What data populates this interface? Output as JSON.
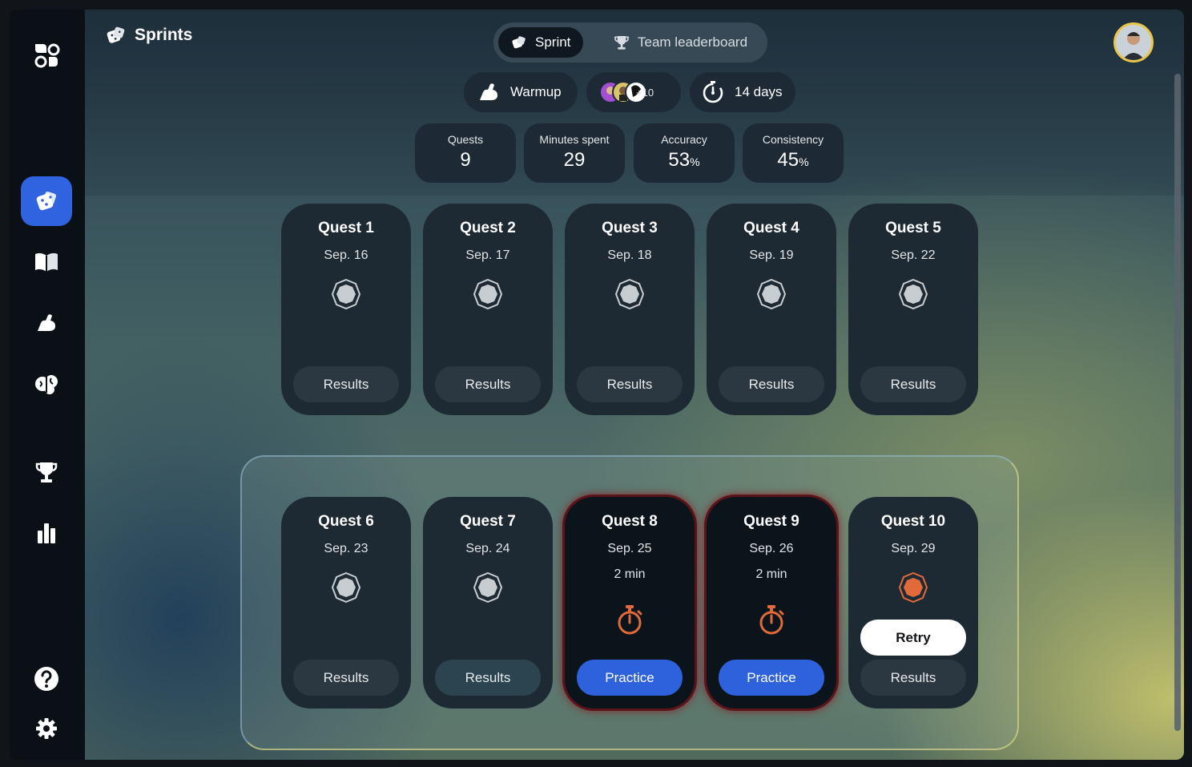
{
  "header": {
    "title": "Sprints"
  },
  "tabs": {
    "sprint": "Sprint",
    "leaderboard": "Team leaderboard"
  },
  "pills": {
    "warmup": "Warmup",
    "members_extra": "+10",
    "duration": "14 days"
  },
  "stats": [
    {
      "label": "Quests",
      "value": "9",
      "unit": ""
    },
    {
      "label": "Minutes spent",
      "value": "29",
      "unit": ""
    },
    {
      "label": "Accuracy",
      "value": "53",
      "unit": "%"
    },
    {
      "label": "Consistency",
      "value": "45",
      "unit": "%"
    }
  ],
  "quests": [
    {
      "title": "Quest 1",
      "date": "Sep. 16",
      "results": "Results"
    },
    {
      "title": "Quest 2",
      "date": "Sep. 17",
      "results": "Results"
    },
    {
      "title": "Quest 3",
      "date": "Sep. 18",
      "results": "Results"
    },
    {
      "title": "Quest 4",
      "date": "Sep. 19",
      "results": "Results"
    },
    {
      "title": "Quest 5",
      "date": "Sep. 22",
      "results": "Results"
    },
    {
      "title": "Quest 6",
      "date": "Sep. 23",
      "results": "Results"
    },
    {
      "title": "Quest 7",
      "date": "Sep. 24",
      "results": "Results"
    },
    {
      "title": "Quest 8",
      "date": "Sep. 25",
      "minutes": "2 min",
      "action": "Practice"
    },
    {
      "title": "Quest 9",
      "date": "Sep. 26",
      "minutes": "2 min",
      "action": "Practice"
    },
    {
      "title": "Quest 10",
      "date": "Sep. 29",
      "retry": "Retry",
      "results": "Results"
    }
  ],
  "colors": {
    "accent": "#2f63e0",
    "badge_orange": "#e06a3a",
    "avatar_ring": "#e9c64a"
  },
  "icons": {
    "sidebar": [
      "apps-icon",
      "dice-icon",
      "book-icon",
      "muscle-icon",
      "brain-icon",
      "trophy-icon",
      "chart-icon",
      "help-icon",
      "gear-icon"
    ]
  }
}
